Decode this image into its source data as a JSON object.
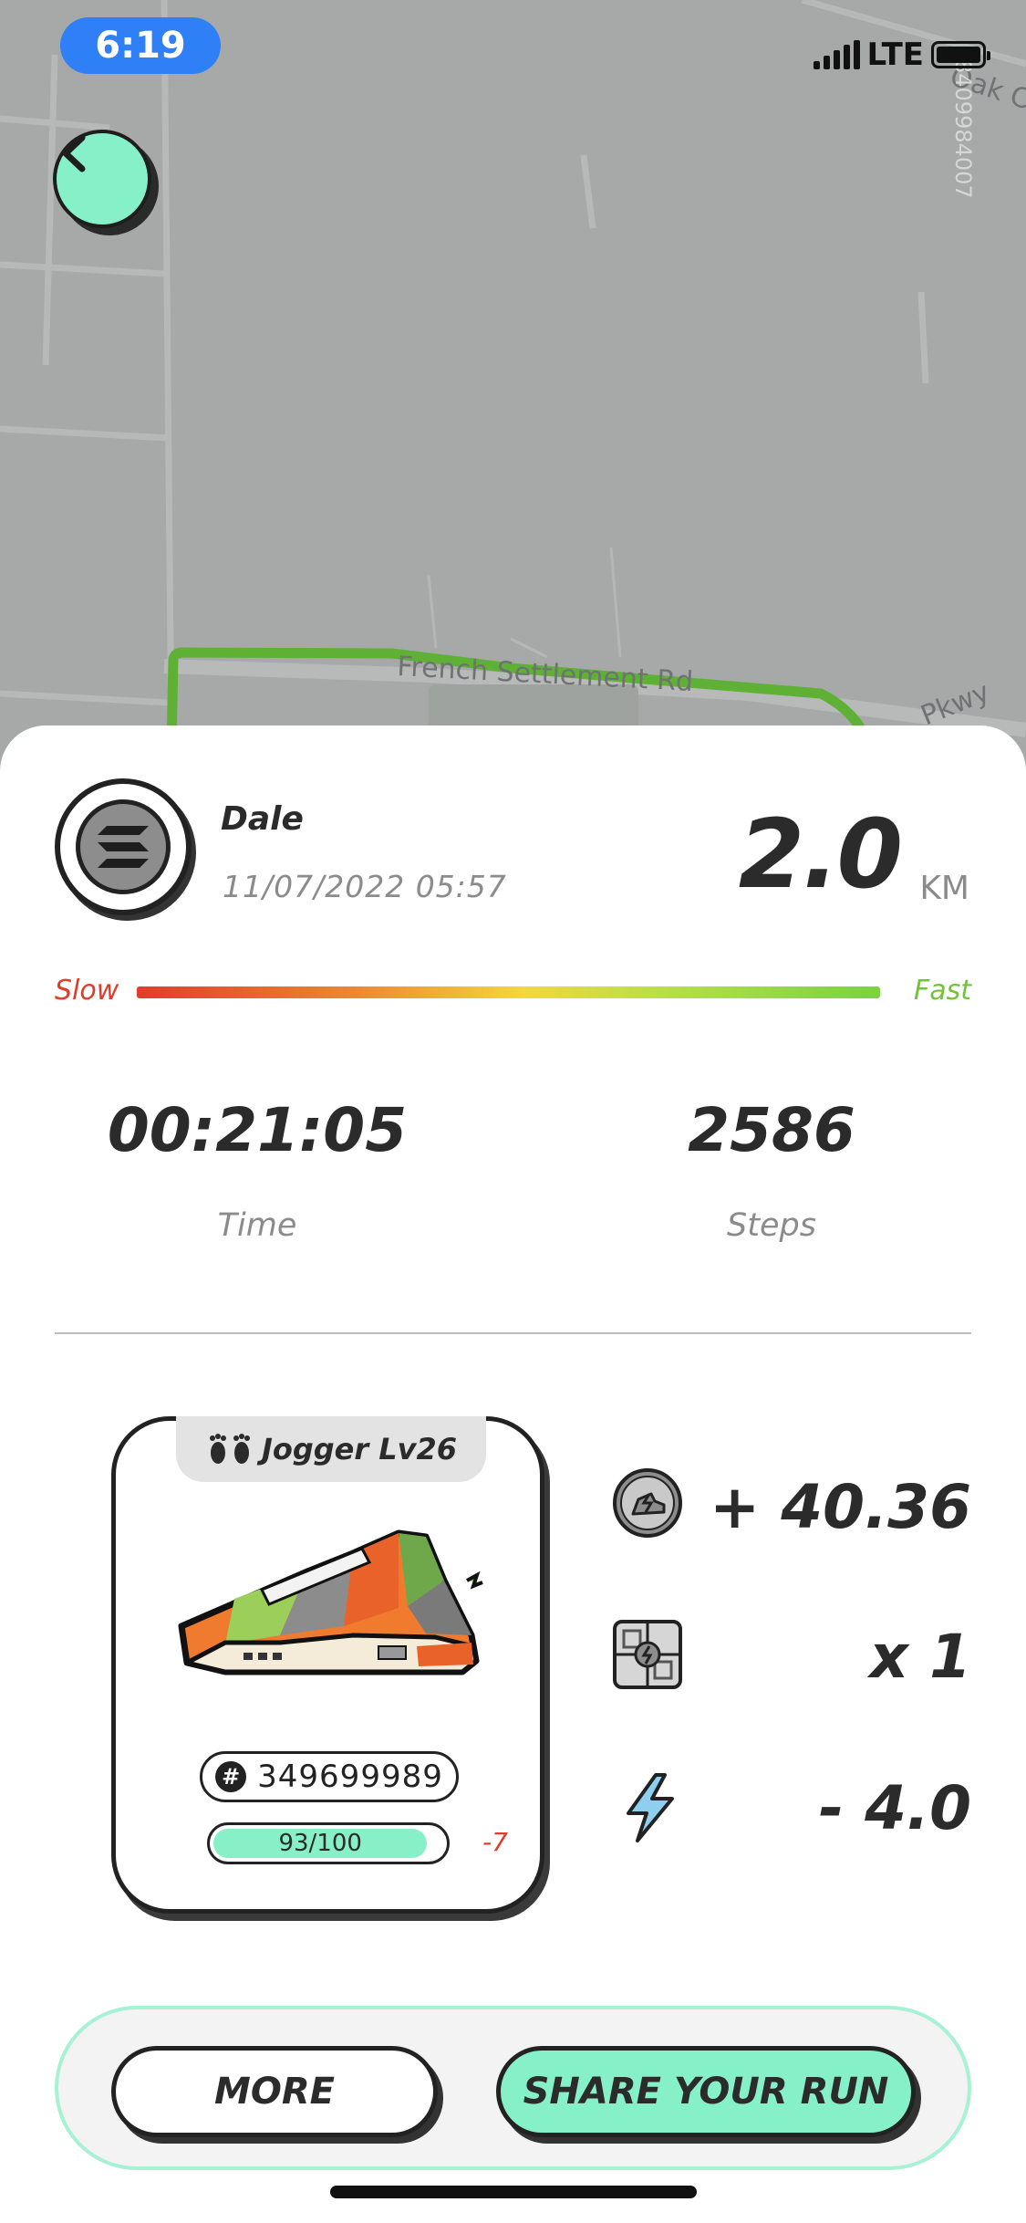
{
  "status_bar": {
    "time": "6:19",
    "network": "LTE"
  },
  "map": {
    "street_labels": [
      "French Settlement Rd",
      "Oak C",
      "Pkwy",
      "8409984007"
    ],
    "route_color": "#5fb135"
  },
  "run": {
    "user_name": "Dale",
    "date": "11/07/2022 05:57",
    "distance": "2.0",
    "distance_unit": "KM",
    "speed_slow_label": "Slow",
    "speed_fast_label": "Fast",
    "time_value": "00:21:05",
    "time_label": "Time",
    "steps_value": "2586",
    "steps_label": "Steps"
  },
  "sneaker": {
    "title": "Jogger Lv26",
    "id_symbol": "#",
    "id": "349699989",
    "durability": "93/100",
    "durability_fraction": 0.93,
    "durability_change": "-7"
  },
  "rewards": {
    "tokens": "+ 40.36",
    "boxes": "x 1",
    "energy": "- 4.0"
  },
  "actions": {
    "more_label": "MORE",
    "share_label": "SHARE YOUR RUN"
  },
  "colors": {
    "accent": "#86f1c8",
    "status_pill": "#2f7ff6",
    "slow": "#e03b2b",
    "fast": "#72c33c"
  }
}
